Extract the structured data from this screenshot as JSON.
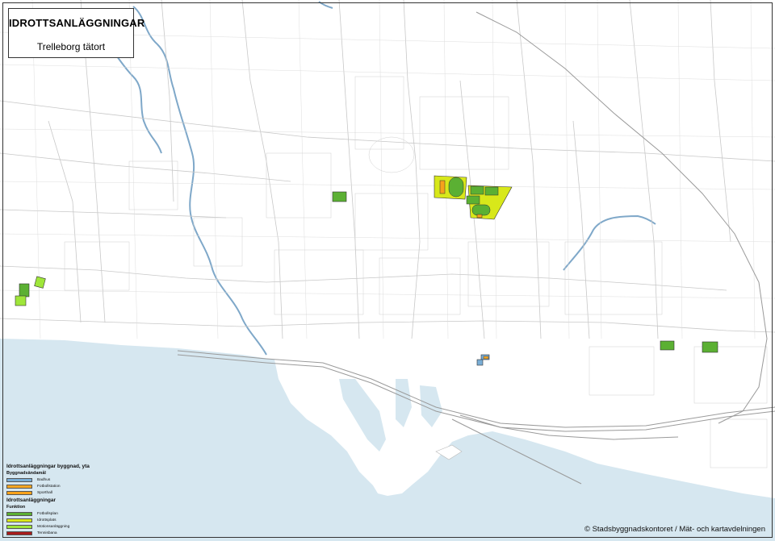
{
  "title": "IDROTTSANLÄGGNINGAR",
  "subtitle": "Trelleborg tätort",
  "legend": {
    "heading1": "Idrottsanläggningar byggnad, yta",
    "group1_title": "Byggnadsändamål",
    "group1_items": [
      {
        "label": "Badhus",
        "color": "#7aaed6"
      },
      {
        "label": "Fotbollstation",
        "color": "#f5a623"
      },
      {
        "label": "Sporthall",
        "color": "#f7a21b"
      }
    ],
    "heading2": "Idrottsanläggningar",
    "group2_title": "Funktion",
    "group2_items": [
      {
        "label": "Fotbollsplan",
        "color": "#5bb033"
      },
      {
        "label": "Idrottsplats",
        "color": "#d8e81a"
      },
      {
        "label": "Motionsanläggning",
        "color": "#9fe63a"
      },
      {
        "label": "Tennisbana",
        "color": "#a81c1c"
      }
    ]
  },
  "copyright": "© Stadsbyggnadskontoret / Mät- och kartavdelningen",
  "colors": {
    "sea": "#d6e7f0",
    "water_line": "#7fa8c9",
    "road": "#c8c8c8",
    "rail": "#9a9a9a",
    "frame": "#333333"
  }
}
